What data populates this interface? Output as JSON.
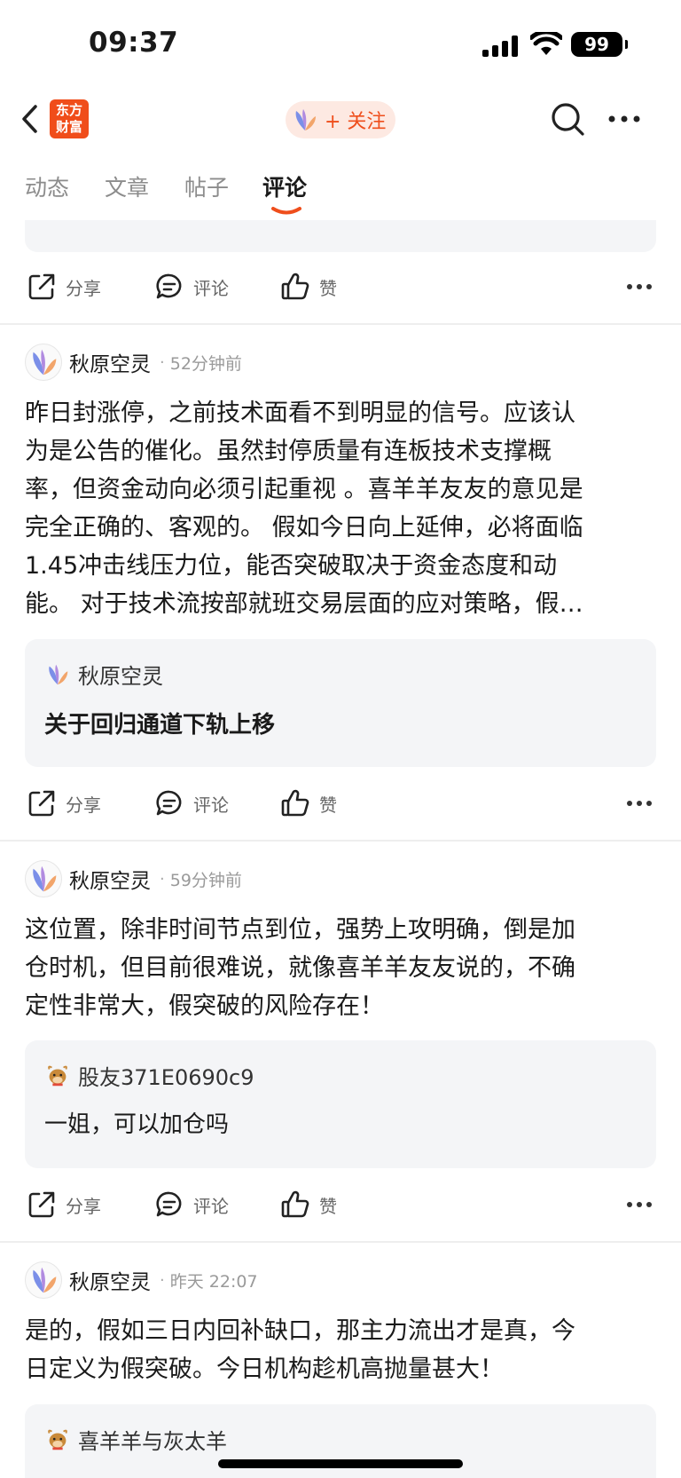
{
  "status_bar": {
    "time": "09:37",
    "battery": "99"
  },
  "header": {
    "logo_line1": "东方",
    "logo_line2": "财富",
    "follow_label": "+ 关注"
  },
  "tabs": [
    {
      "label": "动态",
      "active": false
    },
    {
      "label": "文章",
      "active": false
    },
    {
      "label": "帖子",
      "active": false
    },
    {
      "label": "评论",
      "active": true
    }
  ],
  "actions": {
    "share": "分享",
    "comment": "评论",
    "like": "赞"
  },
  "posts": [
    {
      "author": "秋原空灵",
      "time": "52分钟前",
      "body_lines": [
        "昨日封涨停，之前技术面看不到明显的信号。应该认",
        "为是公告的催化。虽然封停质量有连板技术支撑概",
        "率，但资金动向必须引起重视 。喜羊羊友友的意见是",
        "完全正确的、客观的。 假如今日向上延伸，必将面临",
        "1.45冲击线压力位，能否突破取决于资金态度和动",
        "能。 对于技术流按部就班交易层面的应对策略，假…"
      ],
      "quote": {
        "author": "秋原空灵",
        "text": "关于回归通道下轨上移"
      }
    },
    {
      "author": "秋原空灵",
      "time": "59分钟前",
      "body_lines": [
        "这位置，除非时间节点到位，强势上攻明确，倒是加",
        "仓时机，但目前很难说，就像喜羊羊友友说的，不确",
        "定性非常大，假突破的风险存在！"
      ],
      "quote": {
        "author": "股友371E0690c9",
        "text": "一姐，可以加仓吗"
      }
    },
    {
      "author": "秋原空灵",
      "time": "昨天 22:07",
      "body_lines": [
        "是的，假如三日内回补缺口，那主力流出才是真，今",
        "日定义为假突破。今日机构趁机高抛量甚大！"
      ],
      "quote": {
        "author": "喜羊羊与灰太羊",
        "text": ""
      }
    }
  ]
}
